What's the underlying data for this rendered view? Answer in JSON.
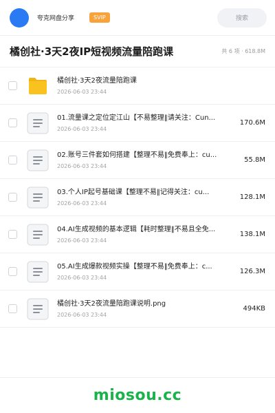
{
  "header": {
    "owner_name": "夸克网盘分享",
    "badge": "SVIP",
    "search_placeholder": "搜索"
  },
  "title_bar": {
    "title": "橘创社·3天2夜IP短视频流量陪跑课",
    "summary": "共 6 项 · 618.8M"
  },
  "files": [
    {
      "type": "folder",
      "name": "橘创社·3天2夜流量陪跑课",
      "date": "2026-06-03 23:44",
      "size": ""
    },
    {
      "type": "doc",
      "name": "01.流量课之定位定江山【不易整理‖请关注：Cun...",
      "date": "2026-06-03 23:44",
      "size": "170.6M"
    },
    {
      "type": "doc",
      "name": "02.账号三件套如何搭建【整理不易‖免费奉上：cu...",
      "date": "2026-06-03 23:44",
      "size": "55.8M"
    },
    {
      "type": "doc",
      "name": "03.个人IP起号基础课【整理不易‖记得关注：cu...",
      "date": "2026-06-03 23:44",
      "size": "128.1M"
    },
    {
      "type": "doc",
      "name": "04.AI生成视频的基本逻辑【耗时整理‖不易且全免...",
      "date": "2026-06-03 23:44",
      "size": "138.1M"
    },
    {
      "type": "doc",
      "name": "05.AI生成爆款视频实操【整理不易‖免费奉上：c...",
      "date": "2026-06-03 23:44",
      "size": "126.3M"
    },
    {
      "type": "doc",
      "name": "橘创社·3天2夜流量陪跑课说明.png",
      "date": "2026-06-03 23:44",
      "size": "494KB"
    }
  ],
  "footer": {
    "watermark": "miosou.cc"
  },
  "colors": {
    "avatar": "#2a7bf3",
    "badge": "#f7a23b",
    "folder": "#f9c21f",
    "watermark": "#19b34a"
  }
}
